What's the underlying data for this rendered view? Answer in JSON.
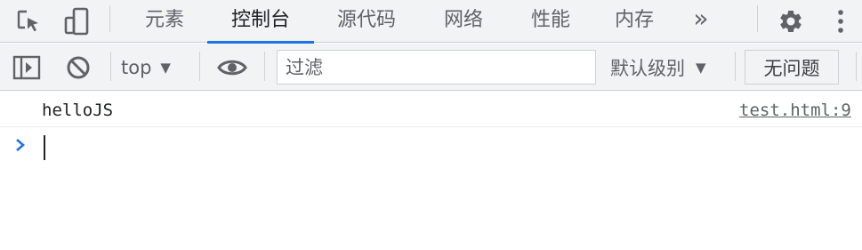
{
  "tabbar": {
    "tabs": [
      {
        "label": "元素",
        "active": false
      },
      {
        "label": "控制台",
        "active": true
      },
      {
        "label": "源代码",
        "active": false
      },
      {
        "label": "网络",
        "active": false
      },
      {
        "label": "性能",
        "active": false
      },
      {
        "label": "内存",
        "active": false
      }
    ],
    "overflow_label": "»",
    "icons": {
      "inspect": "inspect-element-icon",
      "device": "device-toolbar-icon",
      "settings": "gear-icon",
      "more": "more-vertical-icon"
    }
  },
  "toolbar": {
    "context_value": "top",
    "filter_placeholder": "过滤",
    "filter_value": "",
    "level_label": "默认级别",
    "issues_label": "无问题",
    "icons": {
      "sidebar": "sidebar-toggle-icon",
      "clear": "clear-console-icon",
      "live_expression": "eye-icon"
    }
  },
  "console": {
    "messages": [
      {
        "text": "helloJS",
        "source": "test.html:9"
      }
    ]
  },
  "colors": {
    "accent": "#1a73e8",
    "toolbar_bg": "#f1f3f4",
    "icon": "#5f6368"
  }
}
